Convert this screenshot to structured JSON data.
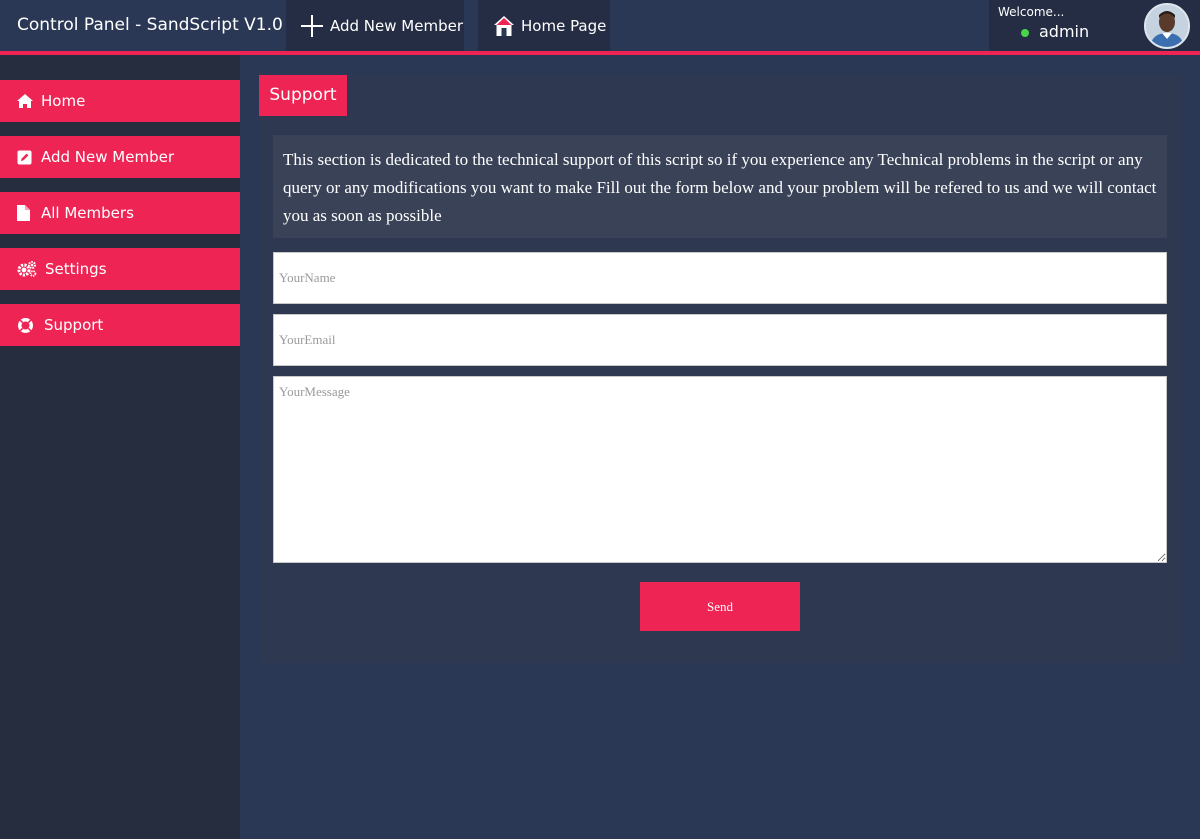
{
  "header": {
    "brand": "Control Panel - SandScript V1.0",
    "nav": [
      {
        "label": "Add New Member",
        "icon": "plus-icon"
      },
      {
        "label": "Home Page",
        "icon": "house-icon"
      }
    ],
    "welcome": "Welcome...",
    "username": "admin"
  },
  "sidebar": {
    "items": [
      {
        "label": "Home",
        "icon": "home-icon"
      },
      {
        "label": "Add New Member",
        "icon": "edit-icon"
      },
      {
        "label": "All Members",
        "icon": "file-icon"
      },
      {
        "label": "Settings",
        "icon": "gears-icon"
      },
      {
        "label": "Support",
        "icon": "lifebuoy-icon"
      }
    ]
  },
  "main": {
    "tab": "Support",
    "description": "This section is dedicated to the technical support of this script so if you experience any Technical problems in the script or any query or any modifications you want to make Fill out the form below and your problem will be refered to us and we will contact you as soon as possible",
    "form": {
      "name_placeholder": "YourName",
      "email_placeholder": "YourEmail",
      "message_placeholder": "YourMessage",
      "send_label": "Send"
    }
  },
  "colors": {
    "accent": "#ee2554",
    "background": "#2b3855",
    "sidebar": "#252d3f",
    "online": "#46d648"
  }
}
